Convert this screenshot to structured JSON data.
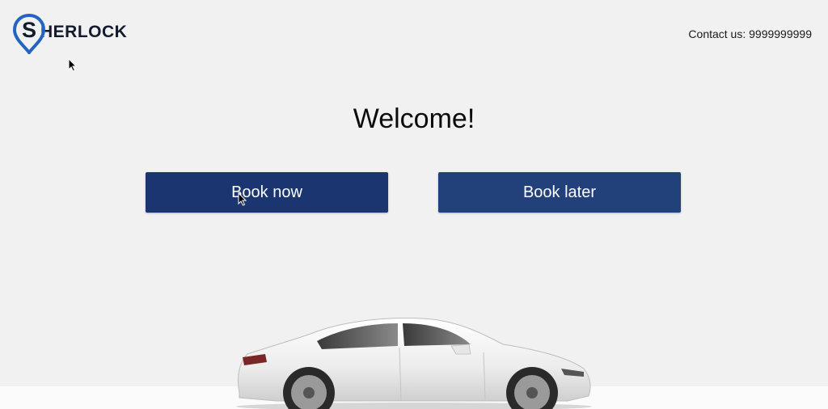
{
  "header": {
    "logo_text": "HERLOCK",
    "logo_letter": "S",
    "contact": "Contact us: 9999999999"
  },
  "main": {
    "heading": "Welcome!",
    "book_now_label": "Book now",
    "book_later_label": "Book later"
  },
  "colors": {
    "background": "#f1f1f1",
    "button": "#1c3a74",
    "logo_blue": "#2563c0",
    "logo_text": "#141a2e"
  },
  "icons": {
    "logo": "location-pin-icon",
    "hero": "car-image",
    "cursor": "mouse-cursor-icon"
  }
}
